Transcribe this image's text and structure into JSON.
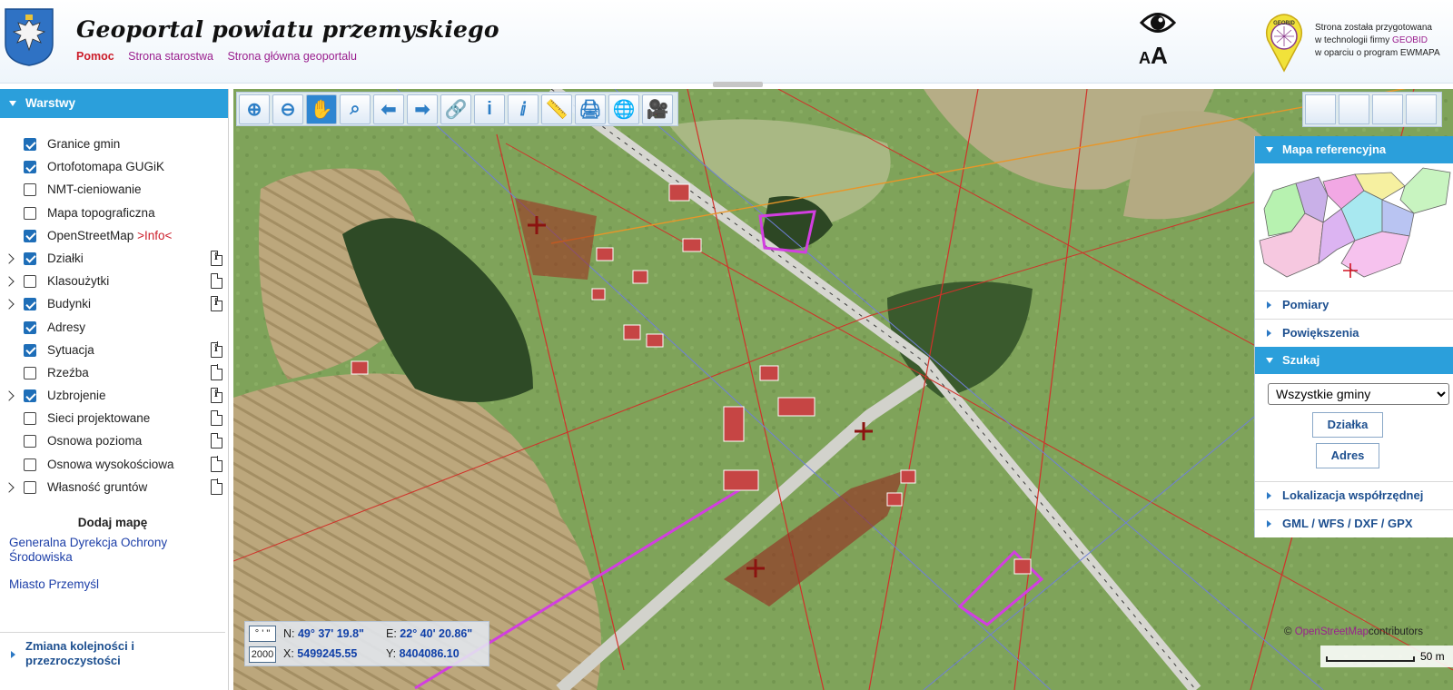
{
  "header": {
    "title": "Geoportal powiatu przemyskiego",
    "links": [
      "Pomoc",
      "Strona starostwa",
      "Strona główna geoportalu"
    ],
    "accessibility_icon": "eye-icon",
    "font_size_icon": "AA",
    "font_size_small": "A",
    "font_size_large": "A",
    "geobid_logo_text": "GEOBID",
    "geobid_line1": "Strona została przygotowana",
    "geobid_line2_prefix": "w technologii firmy",
    "geobid_line2_brand": "GEOBID",
    "geobid_line3": "w oparciu o program EWMAPA"
  },
  "sidebar": {
    "panel_title": "Warstwy",
    "layers": [
      {
        "label": "Granice gmin",
        "checked": true,
        "expandable": false,
        "doc": "none"
      },
      {
        "label": "Ortofotomapa GUGiK",
        "checked": true,
        "expandable": false,
        "doc": "none"
      },
      {
        "label": "NMT-cieniowanie",
        "checked": false,
        "expandable": false,
        "doc": "none"
      },
      {
        "label": "Mapa topograficzna",
        "checked": false,
        "expandable": false,
        "doc": "none"
      },
      {
        "label": "OpenStreetMap",
        "extra": ">Info<",
        "checked": true,
        "expandable": false,
        "doc": "none"
      },
      {
        "label": "Działki",
        "checked": true,
        "expandable": true,
        "doc": "info"
      },
      {
        "label": "Klasoużytki",
        "checked": false,
        "expandable": true,
        "doc": "blank"
      },
      {
        "label": "Budynki",
        "checked": true,
        "expandable": true,
        "doc": "info"
      },
      {
        "label": "Adresy",
        "checked": true,
        "expandable": false,
        "doc": "none"
      },
      {
        "label": "Sytuacja",
        "checked": true,
        "expandable": false,
        "doc": "info"
      },
      {
        "label": "Rzeźba",
        "checked": false,
        "expandable": false,
        "doc": "blank"
      },
      {
        "label": "Uzbrojenie",
        "checked": true,
        "expandable": true,
        "doc": "info"
      },
      {
        "label": "Sieci projektowane",
        "checked": false,
        "expandable": false,
        "doc": "blank"
      },
      {
        "label": "Osnowa pozioma",
        "checked": false,
        "expandable": false,
        "doc": "blank"
      },
      {
        "label": "Osnowa wysokościowa",
        "checked": false,
        "expandable": false,
        "doc": "blank"
      },
      {
        "label": "Własność gruntów",
        "checked": false,
        "expandable": true,
        "doc": "blank"
      }
    ],
    "add_map_title": "Dodaj mapę",
    "add_map_links": [
      "Generalna Dyrekcja Ochrony Środowiska",
      "Miasto Przemyśl"
    ],
    "footer": "Zmiana kolejności i przezroczystości",
    "doc_info_glyph": "i"
  },
  "toolbar": {
    "tools": [
      {
        "name": "zoom-in-icon",
        "glyph": "⊕"
      },
      {
        "name": "zoom-out-icon",
        "glyph": "⊖"
      },
      {
        "name": "pan-hand-icon",
        "glyph": "✋"
      },
      {
        "name": "zoom-extent-icon",
        "glyph": "⌕"
      },
      {
        "name": "previous-view-icon",
        "glyph": "⬅"
      },
      {
        "name": "next-view-icon",
        "glyph": "➡"
      },
      {
        "name": "link-icon",
        "glyph": "🔗"
      },
      {
        "name": "info-icon",
        "glyph": "i"
      },
      {
        "name": "info-query-icon",
        "glyph": "ⅈ"
      },
      {
        "name": "measure-icon",
        "glyph": "📏"
      },
      {
        "name": "print-icon",
        "glyph": "🖨"
      },
      {
        "name": "globe-icon",
        "glyph": "🌐"
      },
      {
        "name": "video-icon",
        "glyph": "🎥"
      }
    ]
  },
  "right_panel": {
    "ref_map_title": "Mapa referencyjna",
    "items": [
      "Pomiary",
      "Powiększenia"
    ],
    "search_title": "Szukaj",
    "gmina_select": "Wszystkie gminy",
    "buttons": [
      "Działka",
      "Adres"
    ],
    "bottom_items": [
      "Lokalizacja współrzędnej",
      "GML / WFS / DXF / GPX"
    ]
  },
  "coords": {
    "format_dms": "° ' \"",
    "format_2000": "2000",
    "n_label": "N:",
    "n_value": "49° 37' 19.8\"",
    "e_label": "E:",
    "e_value": "22° 40' 20.86\"",
    "x_label": "X:",
    "x_value": "5499245.55",
    "y_label": "Y:",
    "y_value": "8404086.10"
  },
  "attribution": {
    "prefix": "©",
    "link": "OpenStreetMap",
    "suffix": "contributors"
  },
  "scale": "50 m",
  "colors": {
    "accent": "#2b9fdb",
    "link": "#1d3fa8",
    "pomoc": "#cc1e2a",
    "links": "#9a1f8e"
  }
}
